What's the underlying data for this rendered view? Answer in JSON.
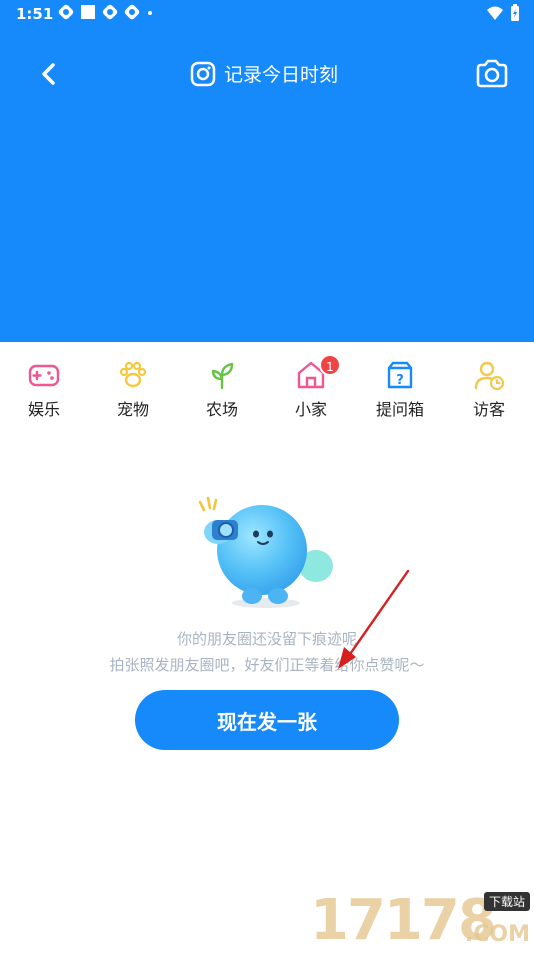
{
  "status_bar": {
    "time": "1:51"
  },
  "header": {
    "title": "记录今日时刻"
  },
  "nav": {
    "items": [
      {
        "label": "娱乐",
        "icon": "gamepad-icon",
        "color": "#f0568f"
      },
      {
        "label": "宠物",
        "icon": "paw-icon",
        "color": "#f6c93c"
      },
      {
        "label": "农场",
        "icon": "sprout-icon",
        "color": "#67c346"
      },
      {
        "label": "小家",
        "icon": "house-icon",
        "color": "#f0568f",
        "badge": "1"
      },
      {
        "label": "提问箱",
        "icon": "question-box-icon",
        "color": "#1689fb"
      },
      {
        "label": "访客",
        "icon": "visitor-icon",
        "color": "#f2c94c"
      }
    ]
  },
  "empty_state": {
    "line1": "你的朋友圈还没留下痕迹呢",
    "line2": "拍张照发朋友圈吧，好友们正等着给你点赞呢～"
  },
  "post_button": {
    "label": "现在发一张"
  },
  "watermark": {
    "number": "17178",
    "tag": "下载站",
    "domain": ".COM"
  },
  "colors": {
    "primary": "#1689fb",
    "badge": "#f04444",
    "hint_text": "#a9b4c2"
  }
}
